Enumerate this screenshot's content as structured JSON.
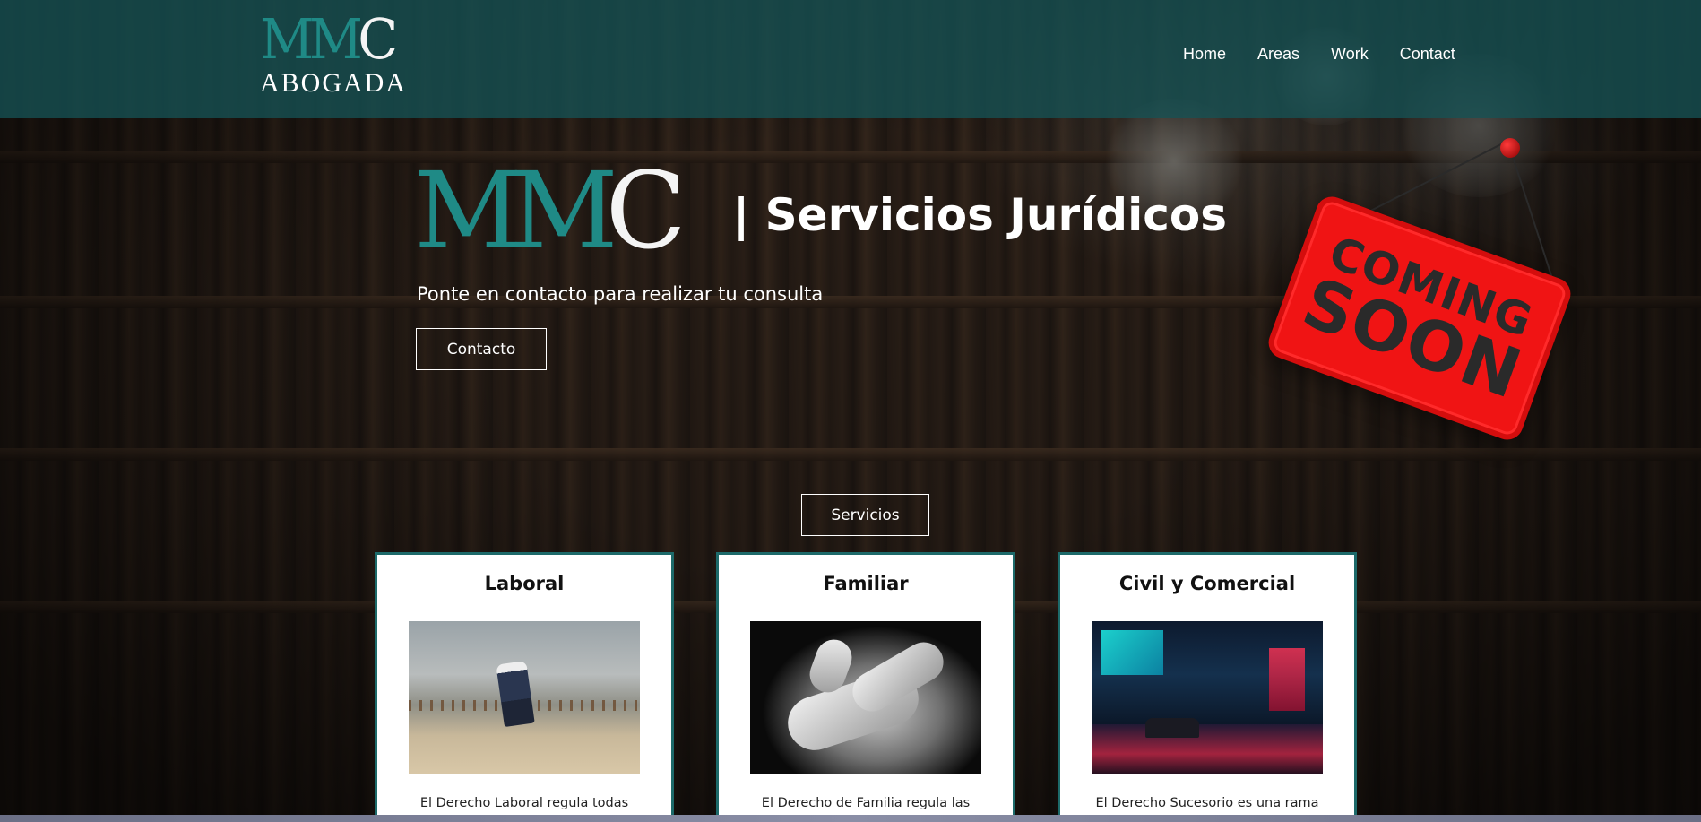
{
  "brand": {
    "mark_part1": "MM",
    "mark_part2": "C",
    "subtitle": "ABOGADA"
  },
  "nav": {
    "items": [
      {
        "label": "Home"
      },
      {
        "label": "Areas"
      },
      {
        "label": "Work"
      },
      {
        "label": "Contact"
      }
    ]
  },
  "hero": {
    "logo_part1": "MM",
    "logo_part2": "C",
    "title": "| Servicios Jurídicos",
    "subtitle": "Ponte en contacto para realizar tu consulta",
    "contact_button": "Contacto"
  },
  "sign": {
    "line1": "COMING",
    "line2": "SOON"
  },
  "services": {
    "button": "Servicios",
    "cards": [
      {
        "title": "Laboral",
        "text": "El Derecho Laboral regula todas"
      },
      {
        "title": "Familiar",
        "text": "El Derecho de Familia regula las"
      },
      {
        "title": "Civil y Comercial",
        "text": "El Derecho Sucesorio es una rama"
      }
    ]
  },
  "colors": {
    "brand_teal": "#1f8a86",
    "header_bg": "#165254",
    "card_border": "#1d6a6a",
    "sign_red": "#f01414"
  }
}
